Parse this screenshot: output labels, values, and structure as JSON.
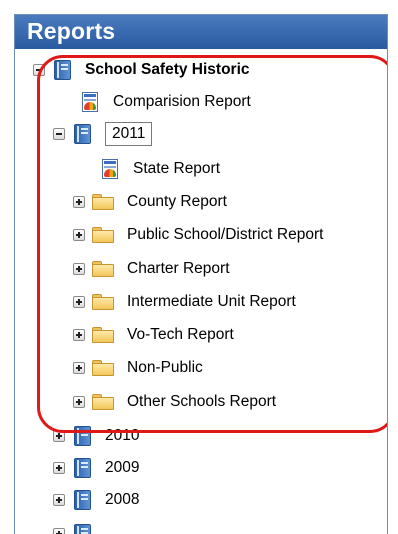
{
  "panel": {
    "title": "Reports"
  },
  "tree": {
    "root": {
      "label": "School Safety Historic",
      "state": "expanded"
    },
    "comparison_report": {
      "label": "Comparision Report"
    },
    "year_2011": {
      "label": "2011",
      "state": "expanded",
      "state_report": {
        "label": "State Report"
      },
      "folders": [
        {
          "label": "County Report"
        },
        {
          "label": "Public School/District Report"
        },
        {
          "label": "Charter Report"
        },
        {
          "label": "Intermediate Unit Report"
        },
        {
          "label": "Vo-Tech Report"
        },
        {
          "label": "Non-Public"
        },
        {
          "label": "Other Schools Report"
        }
      ]
    },
    "other_years": [
      {
        "label": "2010",
        "state": "collapsed"
      },
      {
        "label": "2009",
        "state": "collapsed"
      },
      {
        "label": "2008",
        "state": "collapsed"
      }
    ]
  },
  "colors": {
    "titlebar": "#2f62aa",
    "highlight": "#e01818",
    "folder": "#f4c65c",
    "book": "#3a72bd"
  },
  "icons": {
    "expand": "plus-box-icon",
    "collapse": "minus-box-icon",
    "book": "book-icon",
    "folder": "folder-icon",
    "report": "report-icon"
  }
}
